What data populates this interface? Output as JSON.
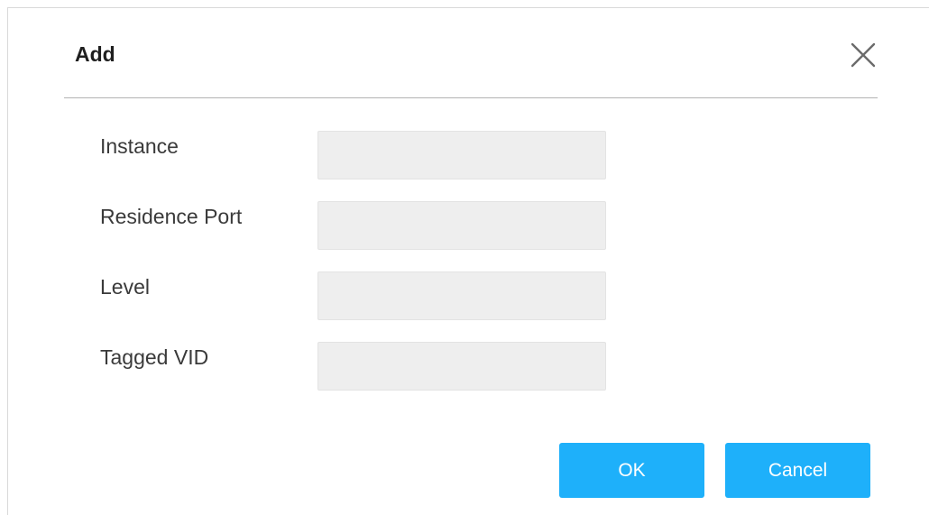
{
  "dialog": {
    "title": "Add",
    "close_icon": "close-icon"
  },
  "form": {
    "fields": [
      {
        "label": "Instance",
        "value": "",
        "placeholder": ""
      },
      {
        "label": "Residence Port",
        "value": "",
        "placeholder": ""
      },
      {
        "label": "Level",
        "value": "",
        "placeholder": ""
      },
      {
        "label": "Tagged VID",
        "value": "",
        "placeholder": ""
      }
    ]
  },
  "actions": {
    "ok_label": "OK",
    "cancel_label": "Cancel"
  },
  "colors": {
    "accent": "#1eb0fa",
    "input_bg": "#eeeeee",
    "divider": "#b3b3b3"
  }
}
